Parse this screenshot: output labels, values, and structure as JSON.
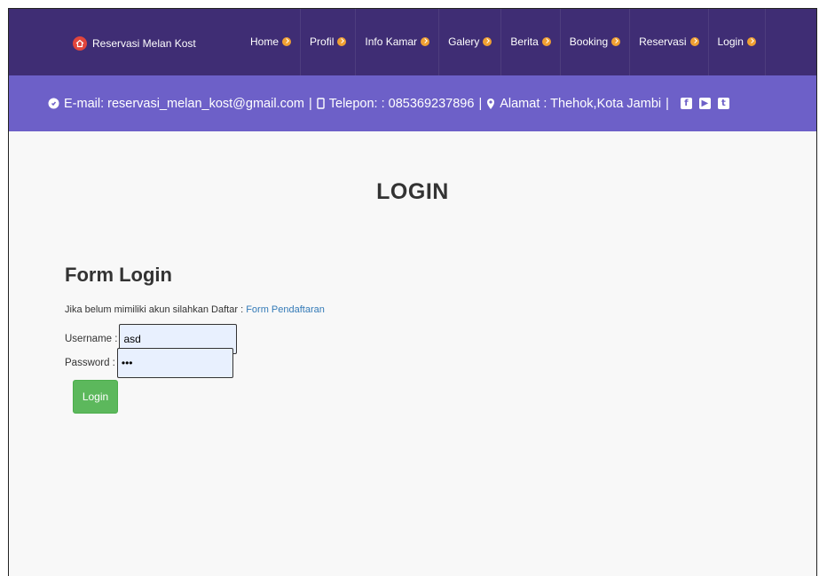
{
  "navbar": {
    "brand": "Reservasi Melan Kost",
    "items": [
      {
        "label": "Home"
      },
      {
        "label": "Profil"
      },
      {
        "label": "Info Kamar"
      },
      {
        "label": "Galery"
      },
      {
        "label": "Berita"
      },
      {
        "label": "Booking"
      },
      {
        "label": "Reservasi"
      },
      {
        "label": "Login"
      }
    ]
  },
  "infobar": {
    "email": "E-mail: reservasi_melan_kost@gmail.com",
    "separator": "|",
    "phone": "Telepon: : 085369237896",
    "address": "Alamat : Thehok,Kota Jambi"
  },
  "page": {
    "title": "LOGIN"
  },
  "form": {
    "title": "Form Login",
    "note": "Jika belum mimiliki akun silahkan Daftar : ",
    "register_link": "Form Pendaftaran",
    "username_label": "Username :",
    "username_value": "asd",
    "password_label": "Password :",
    "password_value": "asd",
    "login_button": "Login"
  },
  "colors": {
    "navbar": "#3f2d74",
    "infobar": "#6d60c8",
    "accent_dot": "#f0a032",
    "login_button": "#5cb85c",
    "link": "#337ab7"
  }
}
